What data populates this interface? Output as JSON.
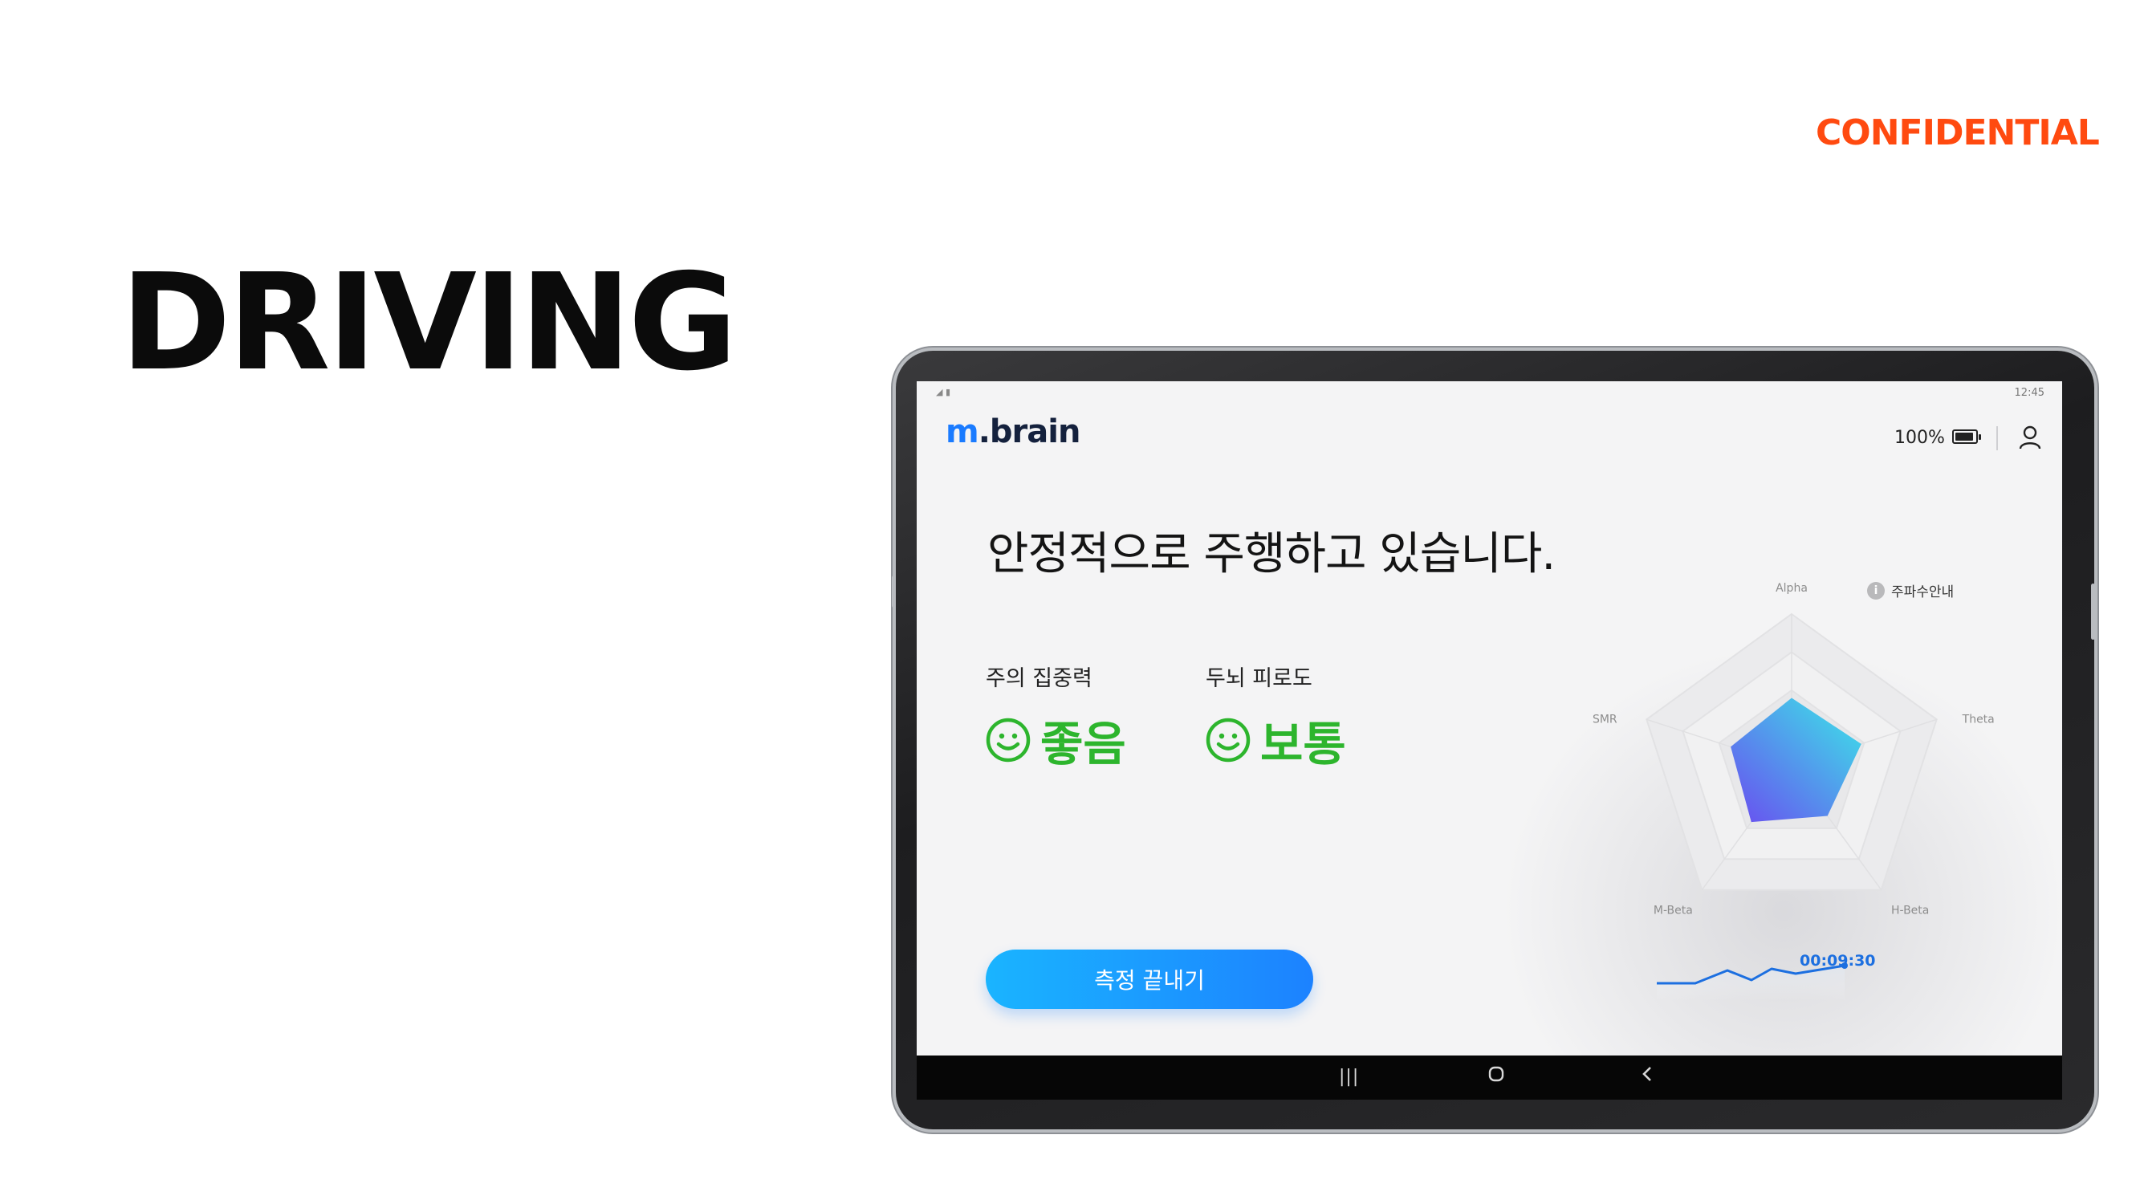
{
  "slide": {
    "confidential_label": "CONFIDENTIAL",
    "title": "DRIVING"
  },
  "device": {
    "status_bar": {
      "time": "12:45"
    },
    "app": {
      "logo_accent": "m",
      "logo_rest": ".brain",
      "battery_percent": "100%",
      "headline": "안정적으로 주행하고 있습니다.",
      "metrics": [
        {
          "label": "주의 집중력",
          "value": "좋음",
          "face": "smile-icon"
        },
        {
          "label": "두뇌 피로도",
          "value": "보통",
          "face": "smile-icon"
        }
      ],
      "end_button_label": "측정 끝내기",
      "frequency_info_label": "주파수안내",
      "timer": "00:09:30"
    },
    "nav_bar": {
      "recents": "recents-icon",
      "home": "home-icon",
      "back": "back-icon"
    }
  },
  "chart_data": {
    "type": "radar",
    "axes": [
      "Alpha",
      "Theta",
      "H-Beta",
      "M-Beta",
      "SMR"
    ],
    "values": [
      0.45,
      0.48,
      0.4,
      0.45,
      0.42
    ],
    "range": [
      0,
      1
    ],
    "grid_levels": 4,
    "fill_gradient": [
      "#6a4cf0",
      "#3be8e8"
    ]
  },
  "colors": {
    "accent": "#1a7bff",
    "confidential": "#ff4a10",
    "status_good": "#2db52d",
    "timer": "#1c6fe0"
  }
}
